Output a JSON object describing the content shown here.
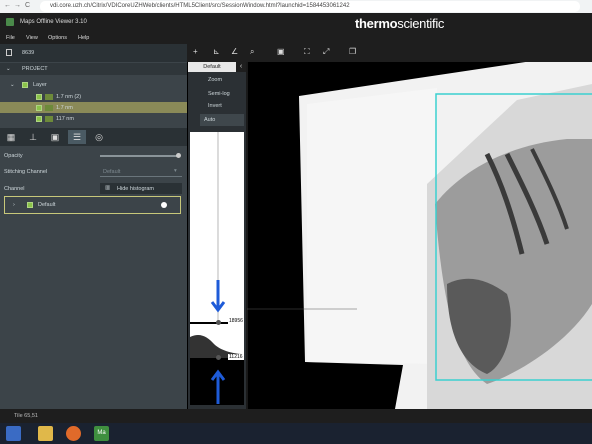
{
  "browser": {
    "url": "vdi.core.uzh.ch/Citrix/VDICoreUZHWeb/clients/HTML5Client/src/SessionWindow.html?launchid=1584453061242",
    "nav_back": "←",
    "nav_forward": "→",
    "nav_reload": "C"
  },
  "app": {
    "title": "Maps Offline Viewer 3.10",
    "logo_a": "thermo",
    "logo_b": "scientific"
  },
  "menu": [
    "File",
    "View",
    "Options",
    "Help"
  ],
  "left": {
    "tile_id": "8639",
    "project_label": "PROJECT",
    "layer_label": "Layer",
    "layers": [
      "1.7 nm (2)",
      "1.7 nm",
      "117 nm"
    ],
    "opacity_label": "Opacity",
    "stitching_label": "Stitching Channel",
    "stitching_value": "Default",
    "channel_label": "Channel",
    "hide_histogram": "Hide histogram",
    "channel_name": "Default"
  },
  "histogram": {
    "tab": "Default",
    "options": [
      "Zoom",
      "Semi-log",
      "Invert"
    ],
    "auto_label": "Auto",
    "max_value": "18956",
    "min_value": "11216"
  },
  "status": {
    "text": "Tile 65,51"
  },
  "colors": {
    "accent_cyan": "#3ad0cf",
    "arrow_blue": "#1e5bd8",
    "layer_highlight": "#8a8a58"
  }
}
